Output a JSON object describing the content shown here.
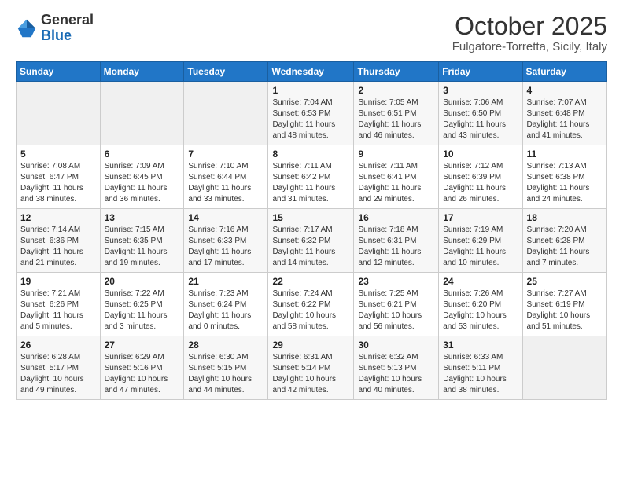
{
  "logo": {
    "general": "General",
    "blue": "Blue"
  },
  "header": {
    "month": "October 2025",
    "location": "Fulgatore-Torretta, Sicily, Italy"
  },
  "weekdays": [
    "Sunday",
    "Monday",
    "Tuesday",
    "Wednesday",
    "Thursday",
    "Friday",
    "Saturday"
  ],
  "weeks": [
    [
      {
        "day": "",
        "info": ""
      },
      {
        "day": "",
        "info": ""
      },
      {
        "day": "",
        "info": ""
      },
      {
        "day": "1",
        "info": "Sunrise: 7:04 AM\nSunset: 6:53 PM\nDaylight: 11 hours and 48 minutes."
      },
      {
        "day": "2",
        "info": "Sunrise: 7:05 AM\nSunset: 6:51 PM\nDaylight: 11 hours and 46 minutes."
      },
      {
        "day": "3",
        "info": "Sunrise: 7:06 AM\nSunset: 6:50 PM\nDaylight: 11 hours and 43 minutes."
      },
      {
        "day": "4",
        "info": "Sunrise: 7:07 AM\nSunset: 6:48 PM\nDaylight: 11 hours and 41 minutes."
      }
    ],
    [
      {
        "day": "5",
        "info": "Sunrise: 7:08 AM\nSunset: 6:47 PM\nDaylight: 11 hours and 38 minutes."
      },
      {
        "day": "6",
        "info": "Sunrise: 7:09 AM\nSunset: 6:45 PM\nDaylight: 11 hours and 36 minutes."
      },
      {
        "day": "7",
        "info": "Sunrise: 7:10 AM\nSunset: 6:44 PM\nDaylight: 11 hours and 33 minutes."
      },
      {
        "day": "8",
        "info": "Sunrise: 7:11 AM\nSunset: 6:42 PM\nDaylight: 11 hours and 31 minutes."
      },
      {
        "day": "9",
        "info": "Sunrise: 7:11 AM\nSunset: 6:41 PM\nDaylight: 11 hours and 29 minutes."
      },
      {
        "day": "10",
        "info": "Sunrise: 7:12 AM\nSunset: 6:39 PM\nDaylight: 11 hours and 26 minutes."
      },
      {
        "day": "11",
        "info": "Sunrise: 7:13 AM\nSunset: 6:38 PM\nDaylight: 11 hours and 24 minutes."
      }
    ],
    [
      {
        "day": "12",
        "info": "Sunrise: 7:14 AM\nSunset: 6:36 PM\nDaylight: 11 hours and 21 minutes."
      },
      {
        "day": "13",
        "info": "Sunrise: 7:15 AM\nSunset: 6:35 PM\nDaylight: 11 hours and 19 minutes."
      },
      {
        "day": "14",
        "info": "Sunrise: 7:16 AM\nSunset: 6:33 PM\nDaylight: 11 hours and 17 minutes."
      },
      {
        "day": "15",
        "info": "Sunrise: 7:17 AM\nSunset: 6:32 PM\nDaylight: 11 hours and 14 minutes."
      },
      {
        "day": "16",
        "info": "Sunrise: 7:18 AM\nSunset: 6:31 PM\nDaylight: 11 hours and 12 minutes."
      },
      {
        "day": "17",
        "info": "Sunrise: 7:19 AM\nSunset: 6:29 PM\nDaylight: 11 hours and 10 minutes."
      },
      {
        "day": "18",
        "info": "Sunrise: 7:20 AM\nSunset: 6:28 PM\nDaylight: 11 hours and 7 minutes."
      }
    ],
    [
      {
        "day": "19",
        "info": "Sunrise: 7:21 AM\nSunset: 6:26 PM\nDaylight: 11 hours and 5 minutes."
      },
      {
        "day": "20",
        "info": "Sunrise: 7:22 AM\nSunset: 6:25 PM\nDaylight: 11 hours and 3 minutes."
      },
      {
        "day": "21",
        "info": "Sunrise: 7:23 AM\nSunset: 6:24 PM\nDaylight: 11 hours and 0 minutes."
      },
      {
        "day": "22",
        "info": "Sunrise: 7:24 AM\nSunset: 6:22 PM\nDaylight: 10 hours and 58 minutes."
      },
      {
        "day": "23",
        "info": "Sunrise: 7:25 AM\nSunset: 6:21 PM\nDaylight: 10 hours and 56 minutes."
      },
      {
        "day": "24",
        "info": "Sunrise: 7:26 AM\nSunset: 6:20 PM\nDaylight: 10 hours and 53 minutes."
      },
      {
        "day": "25",
        "info": "Sunrise: 7:27 AM\nSunset: 6:19 PM\nDaylight: 10 hours and 51 minutes."
      }
    ],
    [
      {
        "day": "26",
        "info": "Sunrise: 6:28 AM\nSunset: 5:17 PM\nDaylight: 10 hours and 49 minutes."
      },
      {
        "day": "27",
        "info": "Sunrise: 6:29 AM\nSunset: 5:16 PM\nDaylight: 10 hours and 47 minutes."
      },
      {
        "day": "28",
        "info": "Sunrise: 6:30 AM\nSunset: 5:15 PM\nDaylight: 10 hours and 44 minutes."
      },
      {
        "day": "29",
        "info": "Sunrise: 6:31 AM\nSunset: 5:14 PM\nDaylight: 10 hours and 42 minutes."
      },
      {
        "day": "30",
        "info": "Sunrise: 6:32 AM\nSunset: 5:13 PM\nDaylight: 10 hours and 40 minutes."
      },
      {
        "day": "31",
        "info": "Sunrise: 6:33 AM\nSunset: 5:11 PM\nDaylight: 10 hours and 38 minutes."
      },
      {
        "day": "",
        "info": ""
      }
    ]
  ]
}
